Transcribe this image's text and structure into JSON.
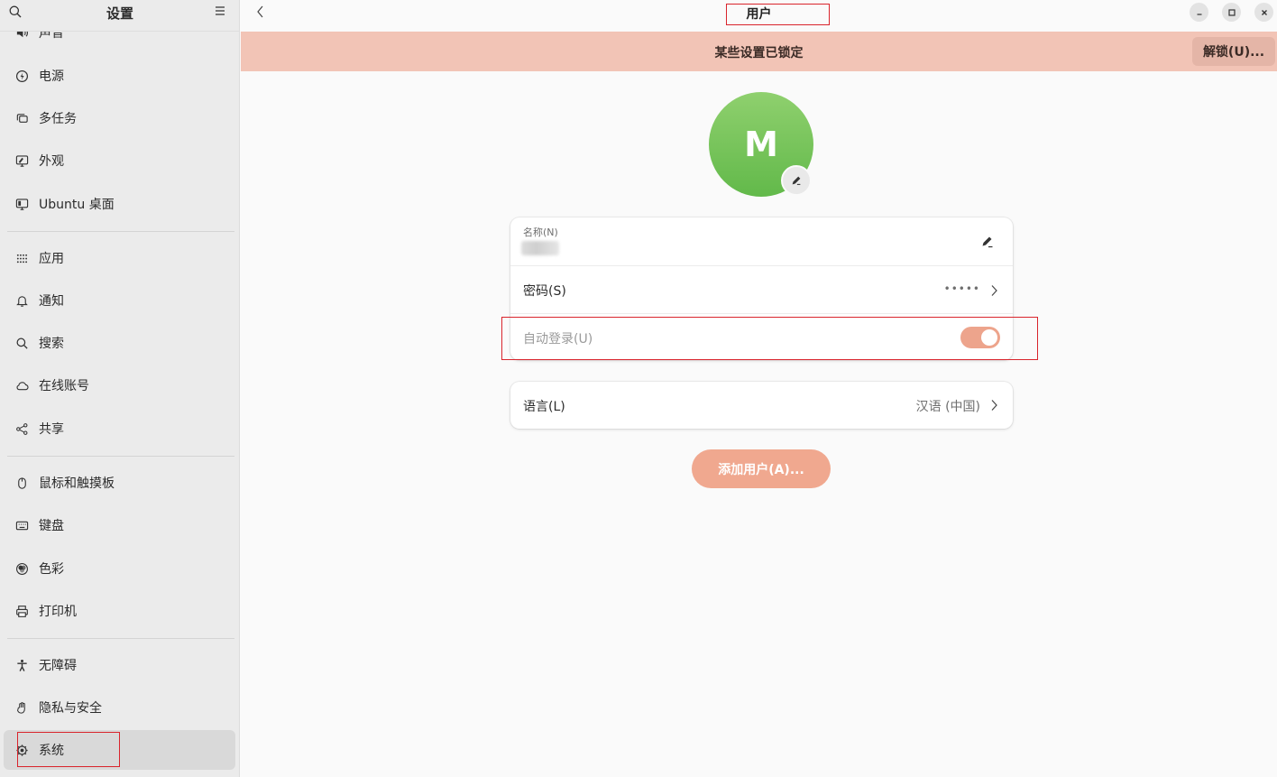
{
  "sidebar": {
    "title": "设置",
    "search_icon": "search-icon",
    "menu_icon": "hamburger-menu-icon",
    "items": [
      {
        "label": "声音",
        "icon": "speaker-icon"
      },
      {
        "label": "电源",
        "icon": "power-icon"
      },
      {
        "label": "多任务",
        "icon": "multitask-icon"
      },
      {
        "label": "外观",
        "icon": "appearance-icon"
      },
      {
        "label": "Ubuntu 桌面",
        "icon": "desktop-icon"
      },
      {
        "label": "应用",
        "icon": "apps-grid-icon"
      },
      {
        "label": "通知",
        "icon": "bell-icon"
      },
      {
        "label": "搜索",
        "icon": "search-icon"
      },
      {
        "label": "在线账号",
        "icon": "cloud-icon"
      },
      {
        "label": "共享",
        "icon": "share-icon"
      },
      {
        "label": "鼠标和触摸板",
        "icon": "mouse-icon"
      },
      {
        "label": "键盘",
        "icon": "keyboard-icon"
      },
      {
        "label": "色彩",
        "icon": "color-icon"
      },
      {
        "label": "打印机",
        "icon": "printer-icon"
      },
      {
        "label": "无障碍",
        "icon": "accessibility-icon"
      },
      {
        "label": "隐私与安全",
        "icon": "hand-icon"
      },
      {
        "label": "系统",
        "icon": "system-gear-icon",
        "active": true
      }
    ]
  },
  "header": {
    "title": "用户",
    "back_icon": "chevron-left-icon",
    "window_controls": [
      "minimize-icon",
      "maximize-icon",
      "close-icon"
    ]
  },
  "banner": {
    "text": "某些设置已锁定",
    "unlock_label": "解锁(U)..."
  },
  "user": {
    "avatar_letter": "M",
    "avatar_color": "#6cbf52",
    "name_label": "名称(N)",
    "password_label": "密码(S)",
    "password_value": "•••••",
    "autologin_label": "自动登录(U)",
    "autologin_on": true,
    "language_label": "语言(L)",
    "language_value": "汉语 (中国)"
  },
  "actions": {
    "add_user_label": "添加用户(A)..."
  },
  "colors": {
    "banner_bg": "#f2c4b6",
    "accent": "#f0a88f",
    "toggle_on": "#eda48c",
    "highlight_box": "#d9242c"
  }
}
